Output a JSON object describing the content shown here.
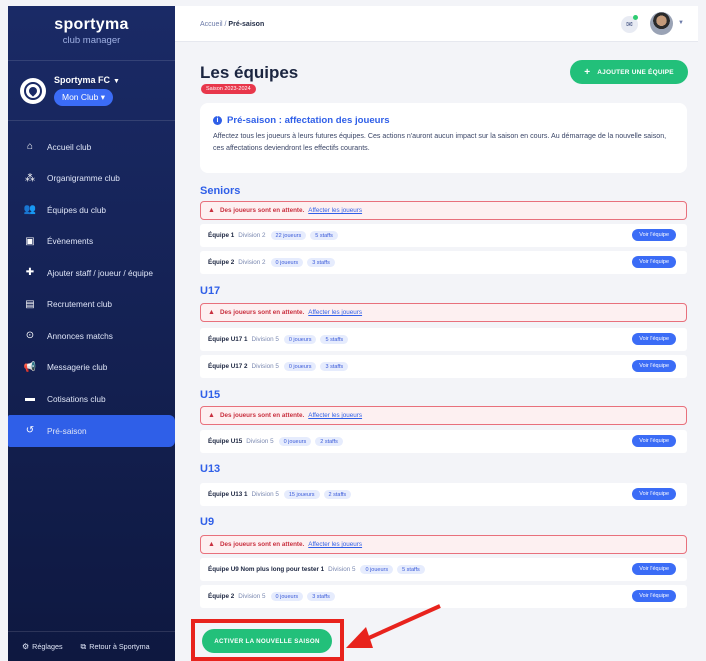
{
  "sidebar": {
    "brand": "sportyma",
    "brand_sub": "club manager",
    "club_name": "Sportyma FC",
    "club_select": "Mon Club",
    "items": [
      {
        "label": "Accueil club",
        "icon": "home-icon"
      },
      {
        "label": "Organigramme club",
        "icon": "org-chart-icon"
      },
      {
        "label": "Équipes du club",
        "icon": "teams-icon"
      },
      {
        "label": "Évènements",
        "icon": "calendar-icon"
      },
      {
        "label": "Ajouter staff / joueur / équipe",
        "icon": "add-user-icon"
      },
      {
        "label": "Recrutement club",
        "icon": "briefcase-icon"
      },
      {
        "label": "Annonces matchs",
        "icon": "ball-icon"
      },
      {
        "label": "Messagerie club",
        "icon": "megaphone-icon"
      },
      {
        "label": "Cotisations club",
        "icon": "card-icon"
      },
      {
        "label": "Pré-saison",
        "icon": "history-icon"
      }
    ],
    "active_index": 9,
    "footer": {
      "settings": "Réglages",
      "back": "Retour à Sportyma"
    }
  },
  "header": {
    "breadcrumb_root": "Accueil",
    "breadcrumb_sep": " / ",
    "breadcrumb_current": "Pré-saison"
  },
  "page": {
    "title": "Les équipes",
    "season_badge": "Saison 2023-2024",
    "add_team": "AJOUTER UNE ÉQUIPE",
    "info_title": "Pré-saison : affectation des joueurs",
    "info_text": "Affectez tous les joueurs à leurs futures équipes. Ces actions n'auront aucun impact sur la saison en cours. Au démarrage de la nouvelle saison, ces affectations deviendront les effectifs courants.",
    "alert_text": "Des joueurs sont en attente.",
    "alert_link": "Affecter les joueurs",
    "see_team": "Voir l'équipe",
    "activate": "ACTIVER LA NOUVELLE SAISON"
  },
  "sections": [
    {
      "name": "Seniors",
      "alert": true,
      "teams": [
        {
          "name": "Équipe 1",
          "division": "Division 2",
          "players": "22 joueurs",
          "staffs": "5 staffs"
        },
        {
          "name": "Équipe 2",
          "division": "Division 2",
          "players": "0 joueurs",
          "staffs": "3 staffs"
        }
      ]
    },
    {
      "name": "U17",
      "alert": true,
      "teams": [
        {
          "name": "Équipe U17 1",
          "division": "Division 5",
          "players": "0 joueurs",
          "staffs": "5 staffs"
        },
        {
          "name": "Équipe U17 2",
          "division": "Division 5",
          "players": "0 joueurs",
          "staffs": "3 staffs"
        }
      ]
    },
    {
      "name": "U15",
      "alert": true,
      "teams": [
        {
          "name": "Équipe U15",
          "division": "Division 5",
          "players": "0 joueurs",
          "staffs": "2 staffs"
        }
      ]
    },
    {
      "name": "U13",
      "alert": false,
      "teams": [
        {
          "name": "Équipe U13 1",
          "division": "Division 5",
          "players": "15 joueurs",
          "staffs": "2 staffs"
        }
      ]
    },
    {
      "name": "U9",
      "alert": true,
      "teams": [
        {
          "name": "Équipe U9 Nom plus long pour tester 1",
          "division": "Division 5",
          "players": "0 joueurs",
          "staffs": "5 staffs"
        },
        {
          "name": "Équipe 2",
          "division": "Division 5",
          "players": "0 joueurs",
          "staffs": "3 staffs"
        }
      ]
    }
  ]
}
